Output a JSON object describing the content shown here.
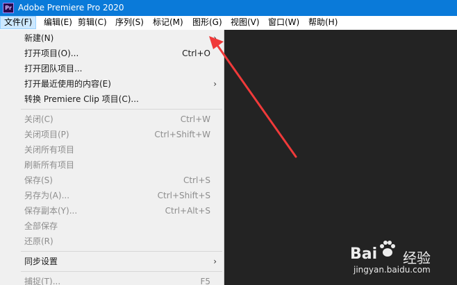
{
  "window": {
    "title": "Adobe Premiere Pro 2020",
    "app_icon_text": "Pr"
  },
  "menubar": {
    "items": [
      {
        "label": "文件(F)"
      },
      {
        "label": "编辑(E)"
      },
      {
        "label": "剪辑(C)"
      },
      {
        "label": "序列(S)"
      },
      {
        "label": "标记(M)"
      },
      {
        "label": "图形(G)"
      },
      {
        "label": "视图(V)"
      },
      {
        "label": "窗口(W)"
      },
      {
        "label": "帮助(H)"
      }
    ]
  },
  "file_menu": {
    "items": [
      {
        "label": "新建(N)",
        "shortcut": "",
        "submenu": true,
        "disabled": false
      },
      {
        "label": "打开项目(O)...",
        "shortcut": "Ctrl+O",
        "submenu": false,
        "disabled": false
      },
      {
        "label": "打开团队项目...",
        "shortcut": "",
        "submenu": false,
        "disabled": false
      },
      {
        "label": "打开最近使用的内容(E)",
        "shortcut": "",
        "submenu": true,
        "disabled": false
      },
      {
        "label": "转换 Premiere Clip 项目(C)...",
        "shortcut": "",
        "submenu": false,
        "disabled": false
      },
      {
        "label": "关闭(C)",
        "shortcut": "Ctrl+W",
        "submenu": false,
        "disabled": true
      },
      {
        "label": "关闭项目(P)",
        "shortcut": "Ctrl+Shift+W",
        "submenu": false,
        "disabled": true
      },
      {
        "label": "关闭所有项目",
        "shortcut": "",
        "submenu": false,
        "disabled": true
      },
      {
        "label": "刷新所有项目",
        "shortcut": "",
        "submenu": false,
        "disabled": true
      },
      {
        "label": "保存(S)",
        "shortcut": "Ctrl+S",
        "submenu": false,
        "disabled": true
      },
      {
        "label": "另存为(A)...",
        "shortcut": "Ctrl+Shift+S",
        "submenu": false,
        "disabled": true
      },
      {
        "label": "保存副本(Y)...",
        "shortcut": "Ctrl+Alt+S",
        "submenu": false,
        "disabled": true
      },
      {
        "label": "全部保存",
        "shortcut": "",
        "submenu": false,
        "disabled": true
      },
      {
        "label": "还原(R)",
        "shortcut": "",
        "submenu": false,
        "disabled": true
      },
      {
        "label": "同步设置",
        "shortcut": "",
        "submenu": true,
        "disabled": false
      },
      {
        "label": "捕捉(T)...",
        "shortcut": "F5",
        "submenu": false,
        "disabled": true
      }
    ]
  },
  "watermark": {
    "logo": "Bai",
    "logo_cn": "经验",
    "url": "jingyan.baidu.com"
  },
  "colors": {
    "titlebar": "#0a7ad9",
    "menubar": "#ffffff",
    "menu_bg": "#f0f0f0",
    "workspace": "#232323",
    "annotation_arrow": "#f03a3a"
  }
}
